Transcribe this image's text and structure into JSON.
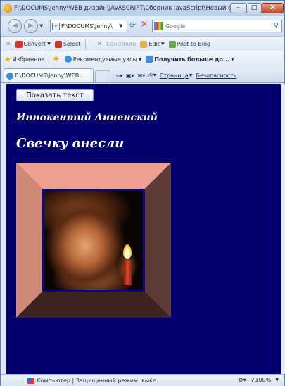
{
  "window": {
    "title": "F:\\DOCUMS\\Jenny\\WEB дизайн\\JAVASCRIPT\\Сборник JavaScript\\Новый сборн...",
    "minimize": "–",
    "maximize": "□",
    "close": "X"
  },
  "address": {
    "url": "F:\\DOCUMS\\Jenny\\",
    "search_placeholder": "Google"
  },
  "toolbar": {
    "convert": "Convert",
    "select": "Select",
    "contribute": "Contribute",
    "edit": "Edit",
    "post": "Post to Blog"
  },
  "favorites": {
    "label": "Избранное",
    "recommended": "Рекомендуемые узлы",
    "more": "Получить больше до..."
  },
  "tab": {
    "title": "F:\\DOCUMS\\Jenny\\WEB..."
  },
  "commands": {
    "page": "Страница",
    "security": "Безопасность"
  },
  "page": {
    "show_button": "Показать текст",
    "author": "Иннокентий Анненский",
    "poem_title": "Свечку внесли"
  },
  "status": {
    "text": "Компьютер | Защищенный режим: выкл.",
    "zoom": "100%"
  },
  "colors": {
    "page_background": "#00006e",
    "frame_top": "#f0a090",
    "frame_left": "#d08877",
    "frame_right": "#5e3b34",
    "frame_bottom": "#3d2420"
  },
  "icons": [
    "ie-icon",
    "back-icon",
    "forward-icon",
    "refresh-icon",
    "stop-icon",
    "google-icon",
    "search-icon",
    "star-icon",
    "flag-icon"
  ]
}
